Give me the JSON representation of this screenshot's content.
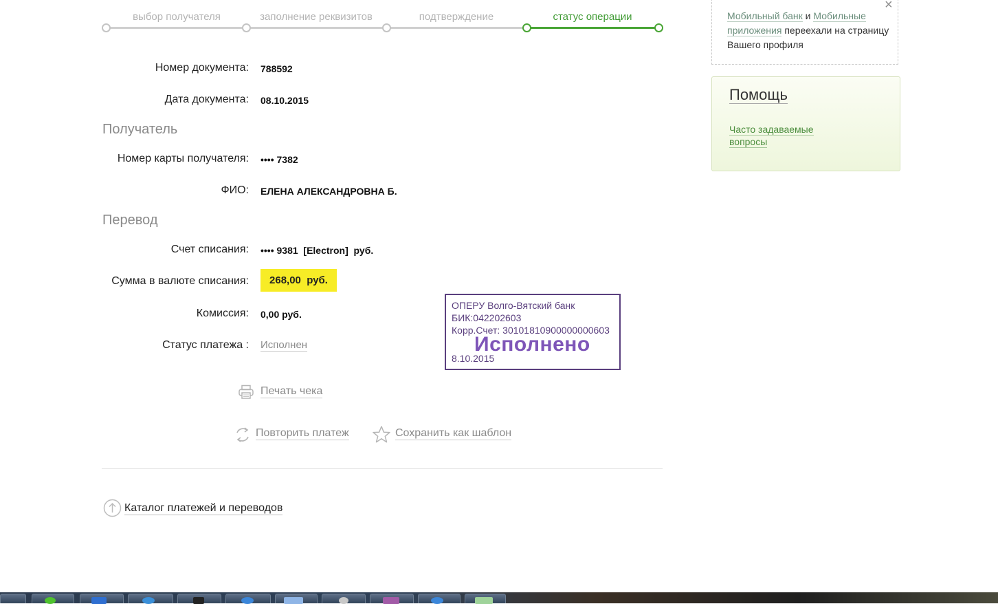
{
  "steps": [
    {
      "label": "выбор получателя",
      "active": false
    },
    {
      "label": "заполнение реквизитов",
      "active": false
    },
    {
      "label": "подтверждение",
      "active": false
    },
    {
      "label": "статус операции",
      "active": true
    }
  ],
  "document": {
    "number_label": "Номер документа:",
    "number_value": "788592",
    "date_label": "Дата документа:",
    "date_value": "08.10.2015"
  },
  "recipient": {
    "section_title": "Получатель",
    "card_label": "Номер карты получателя:",
    "card_value": "•••• 7382",
    "name_label": "ФИО:",
    "name_value": "ЕЛЕНА АЛЕКСАНДРОВНА Б."
  },
  "transfer": {
    "section_title": "Перевод",
    "account_label": "Счет списания:",
    "account_value": "•••• 9381  [Electron]  руб.",
    "amount_label": "Сумма в валюте списания:",
    "amount_value": "268,00  руб.",
    "fee_label": "Комиссия:",
    "fee_value": "0,00 руб.",
    "status_label": "Статус платежа :",
    "status_value": "Исполнен"
  },
  "stamp": {
    "bank": "ОПЕРУ Волго-Вятский банк",
    "bik": "БИК:042202603",
    "corr": "Корр.Счет: 30101810900000000603",
    "status": "Исполнено",
    "date": "8.10.2015"
  },
  "actions": {
    "print_label": "Печать чека",
    "repeat_label": "Повторить платеж",
    "save_template_label": "Сохранить как шаблон",
    "catalog_label": "Каталог платежей и переводов"
  },
  "sidebar": {
    "notice_link1": "Мобильный банк",
    "notice_and": " и ",
    "notice_link2": "Мобильные приложения",
    "notice_rest": " переехали на страницу Вашего профиля",
    "close_symbol": "×",
    "help_title": "Помощь",
    "help_link": "Часто задаваемые вопросы"
  },
  "colors": {
    "accent_green": "#49a535",
    "amount_highlight": "#f7ec26",
    "stamp_purple": "#5a3f7e"
  },
  "icons": [
    "printer-icon",
    "repeat-icon",
    "star-icon",
    "arrow-up-circle-icon",
    "close-icon"
  ]
}
